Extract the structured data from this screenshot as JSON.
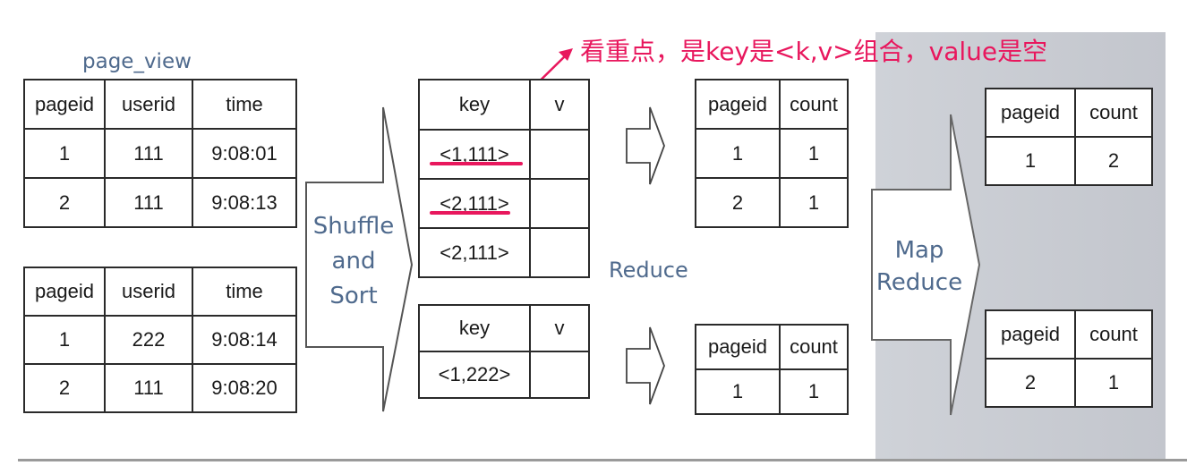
{
  "annotation": "看重点，是key是<k,v>组合，value是空",
  "table_label": "page_view",
  "input_tables": [
    {
      "headers": [
        "pageid",
        "userid",
        "time"
      ],
      "rows": [
        [
          "1",
          "111",
          "9:08:01"
        ],
        [
          "2",
          "111",
          "9:08:13"
        ]
      ]
    },
    {
      "headers": [
        "pageid",
        "userid",
        "time"
      ],
      "rows": [
        [
          "1",
          "222",
          "9:08:14"
        ],
        [
          "2",
          "111",
          "9:08:20"
        ]
      ]
    }
  ],
  "shuffle_label": [
    "Shuffle",
    "and",
    "Sort"
  ],
  "kv_tables": [
    {
      "headers": [
        "key",
        "v"
      ],
      "rows": [
        [
          "<1,111>",
          ""
        ],
        [
          "<2,111>",
          ""
        ],
        [
          "<2,111>",
          ""
        ]
      ]
    },
    {
      "headers": [
        "key",
        "v"
      ],
      "rows": [
        [
          "<1,222>",
          ""
        ]
      ]
    }
  ],
  "reduce_label": "Reduce",
  "reduce_tables": [
    {
      "headers": [
        "pageid",
        "count"
      ],
      "rows": [
        [
          "1",
          "1"
        ],
        [
          "2",
          "1"
        ]
      ]
    },
    {
      "headers": [
        "pageid",
        "count"
      ],
      "rows": [
        [
          "1",
          "1"
        ]
      ]
    }
  ],
  "mapreduce_label": [
    "Map",
    "Reduce"
  ],
  "result_tables": [
    {
      "headers": [
        "pageid",
        "count"
      ],
      "rows": [
        [
          "1",
          "2"
        ]
      ]
    },
    {
      "headers": [
        "pageid",
        "count"
      ],
      "rows": [
        [
          "2",
          "1"
        ]
      ]
    }
  ],
  "colors": {
    "annotation": "#e8175d",
    "label_blue": "#4f6a8d",
    "panel_gray": "#c8cbd1"
  }
}
